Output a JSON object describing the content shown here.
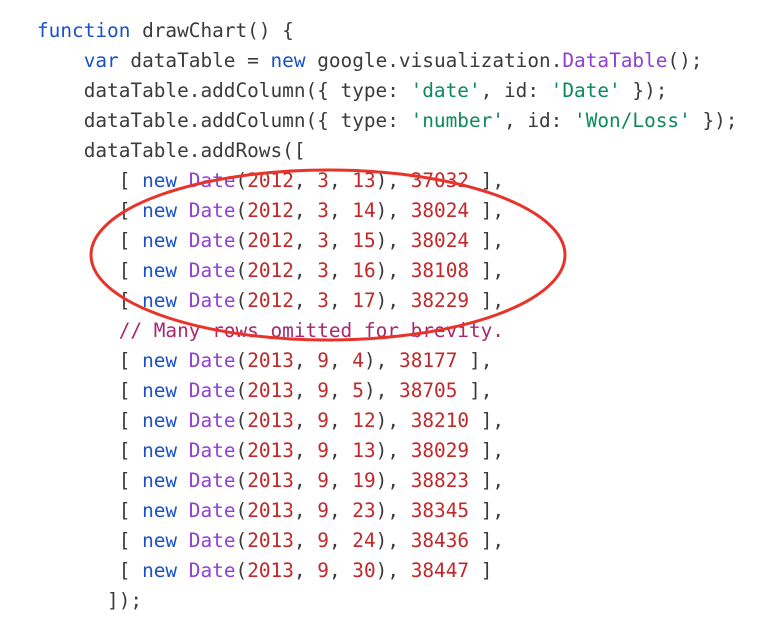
{
  "colors": {
    "keyword": "#1a52c6",
    "identifier": "#3b3b3b",
    "class_name": "#8f3fd1",
    "string": "#0b8a5a",
    "number": "#c0282a",
    "comment": "#a8276d",
    "annotation": "#e8332a",
    "background": "#ffffff"
  },
  "annotation": {
    "shape": "ellipse",
    "color": "#e8332a",
    "encloses_lines": [
      5,
      6,
      7,
      8,
      9
    ]
  },
  "code": {
    "language": "javascript",
    "lines": [
      [
        [
          "kw",
          "function"
        ],
        [
          "id",
          " drawChart() {"
        ]
      ],
      [
        [
          "id",
          "    "
        ],
        [
          "kw",
          "var"
        ],
        [
          "id",
          " dataTable = "
        ],
        [
          "kw",
          "new"
        ],
        [
          "id",
          " google.visualization."
        ],
        [
          "cls",
          "DataTable"
        ],
        [
          "id",
          "();"
        ]
      ],
      [
        [
          "id",
          "    dataTable.addColumn({ type: "
        ],
        [
          "str",
          "'date'"
        ],
        [
          "id",
          ", id: "
        ],
        [
          "str",
          "'Date'"
        ],
        [
          "id",
          " });"
        ]
      ],
      [
        [
          "id",
          "    dataTable.addColumn({ type: "
        ],
        [
          "str",
          "'number'"
        ],
        [
          "id",
          ", id: "
        ],
        [
          "str",
          "'Won/Loss'"
        ],
        [
          "id",
          " });"
        ]
      ],
      [
        [
          "id",
          "    dataTable.addRows(["
        ]
      ],
      [
        [
          "id",
          "       [ "
        ],
        [
          "kw",
          "new"
        ],
        [
          "id",
          " "
        ],
        [
          "cls",
          "Date"
        ],
        [
          "id",
          "("
        ],
        [
          "num",
          "2012"
        ],
        [
          "id",
          ", "
        ],
        [
          "num",
          "3"
        ],
        [
          "id",
          ", "
        ],
        [
          "num",
          "13"
        ],
        [
          "id",
          "), "
        ],
        [
          "num",
          "37032"
        ],
        [
          "id",
          " ],"
        ]
      ],
      [
        [
          "id",
          "       [ "
        ],
        [
          "kw",
          "new"
        ],
        [
          "id",
          " "
        ],
        [
          "cls",
          "Date"
        ],
        [
          "id",
          "("
        ],
        [
          "num",
          "2012"
        ],
        [
          "id",
          ", "
        ],
        [
          "num",
          "3"
        ],
        [
          "id",
          ", "
        ],
        [
          "num",
          "14"
        ],
        [
          "id",
          "), "
        ],
        [
          "num",
          "38024"
        ],
        [
          "id",
          " ],"
        ]
      ],
      [
        [
          "id",
          "       [ "
        ],
        [
          "kw",
          "new"
        ],
        [
          "id",
          " "
        ],
        [
          "cls",
          "Date"
        ],
        [
          "id",
          "("
        ],
        [
          "num",
          "2012"
        ],
        [
          "id",
          ", "
        ],
        [
          "num",
          "3"
        ],
        [
          "id",
          ", "
        ],
        [
          "num",
          "15"
        ],
        [
          "id",
          "), "
        ],
        [
          "num",
          "38024"
        ],
        [
          "id",
          " ],"
        ]
      ],
      [
        [
          "id",
          "       [ "
        ],
        [
          "kw",
          "new"
        ],
        [
          "id",
          " "
        ],
        [
          "cls",
          "Date"
        ],
        [
          "id",
          "("
        ],
        [
          "num",
          "2012"
        ],
        [
          "id",
          ", "
        ],
        [
          "num",
          "3"
        ],
        [
          "id",
          ", "
        ],
        [
          "num",
          "16"
        ],
        [
          "id",
          "), "
        ],
        [
          "num",
          "38108"
        ],
        [
          "id",
          " ],"
        ]
      ],
      [
        [
          "id",
          "       [ "
        ],
        [
          "kw",
          "new"
        ],
        [
          "id",
          " "
        ],
        [
          "cls",
          "Date"
        ],
        [
          "id",
          "("
        ],
        [
          "num",
          "2012"
        ],
        [
          "id",
          ", "
        ],
        [
          "num",
          "3"
        ],
        [
          "id",
          ", "
        ],
        [
          "num",
          "17"
        ],
        [
          "id",
          "), "
        ],
        [
          "num",
          "38229"
        ],
        [
          "id",
          " ],"
        ]
      ],
      [
        [
          "id",
          "       "
        ],
        [
          "com",
          "// Many rows omitted for brevity."
        ]
      ],
      [
        [
          "id",
          "       [ "
        ],
        [
          "kw",
          "new"
        ],
        [
          "id",
          " "
        ],
        [
          "cls",
          "Date"
        ],
        [
          "id",
          "("
        ],
        [
          "num",
          "2013"
        ],
        [
          "id",
          ", "
        ],
        [
          "num",
          "9"
        ],
        [
          "id",
          ", "
        ],
        [
          "num",
          "4"
        ],
        [
          "id",
          "), "
        ],
        [
          "num",
          "38177"
        ],
        [
          "id",
          " ],"
        ]
      ],
      [
        [
          "id",
          "       [ "
        ],
        [
          "kw",
          "new"
        ],
        [
          "id",
          " "
        ],
        [
          "cls",
          "Date"
        ],
        [
          "id",
          "("
        ],
        [
          "num",
          "2013"
        ],
        [
          "id",
          ", "
        ],
        [
          "num",
          "9"
        ],
        [
          "id",
          ", "
        ],
        [
          "num",
          "5"
        ],
        [
          "id",
          "), "
        ],
        [
          "num",
          "38705"
        ],
        [
          "id",
          " ],"
        ]
      ],
      [
        [
          "id",
          "       [ "
        ],
        [
          "kw",
          "new"
        ],
        [
          "id",
          " "
        ],
        [
          "cls",
          "Date"
        ],
        [
          "id",
          "("
        ],
        [
          "num",
          "2013"
        ],
        [
          "id",
          ", "
        ],
        [
          "num",
          "9"
        ],
        [
          "id",
          ", "
        ],
        [
          "num",
          "12"
        ],
        [
          "id",
          "), "
        ],
        [
          "num",
          "38210"
        ],
        [
          "id",
          " ],"
        ]
      ],
      [
        [
          "id",
          "       [ "
        ],
        [
          "kw",
          "new"
        ],
        [
          "id",
          " "
        ],
        [
          "cls",
          "Date"
        ],
        [
          "id",
          "("
        ],
        [
          "num",
          "2013"
        ],
        [
          "id",
          ", "
        ],
        [
          "num",
          "9"
        ],
        [
          "id",
          ", "
        ],
        [
          "num",
          "13"
        ],
        [
          "id",
          "), "
        ],
        [
          "num",
          "38029"
        ],
        [
          "id",
          " ],"
        ]
      ],
      [
        [
          "id",
          "       [ "
        ],
        [
          "kw",
          "new"
        ],
        [
          "id",
          " "
        ],
        [
          "cls",
          "Date"
        ],
        [
          "id",
          "("
        ],
        [
          "num",
          "2013"
        ],
        [
          "id",
          ", "
        ],
        [
          "num",
          "9"
        ],
        [
          "id",
          ", "
        ],
        [
          "num",
          "19"
        ],
        [
          "id",
          "), "
        ],
        [
          "num",
          "38823"
        ],
        [
          "id",
          " ],"
        ]
      ],
      [
        [
          "id",
          "       [ "
        ],
        [
          "kw",
          "new"
        ],
        [
          "id",
          " "
        ],
        [
          "cls",
          "Date"
        ],
        [
          "id",
          "("
        ],
        [
          "num",
          "2013"
        ],
        [
          "id",
          ", "
        ],
        [
          "num",
          "9"
        ],
        [
          "id",
          ", "
        ],
        [
          "num",
          "23"
        ],
        [
          "id",
          "), "
        ],
        [
          "num",
          "38345"
        ],
        [
          "id",
          " ],"
        ]
      ],
      [
        [
          "id",
          "       [ "
        ],
        [
          "kw",
          "new"
        ],
        [
          "id",
          " "
        ],
        [
          "cls",
          "Date"
        ],
        [
          "id",
          "("
        ],
        [
          "num",
          "2013"
        ],
        [
          "id",
          ", "
        ],
        [
          "num",
          "9"
        ],
        [
          "id",
          ", "
        ],
        [
          "num",
          "24"
        ],
        [
          "id",
          "), "
        ],
        [
          "num",
          "38436"
        ],
        [
          "id",
          " ],"
        ]
      ],
      [
        [
          "id",
          "       [ "
        ],
        [
          "kw",
          "new"
        ],
        [
          "id",
          " "
        ],
        [
          "cls",
          "Date"
        ],
        [
          "id",
          "("
        ],
        [
          "num",
          "2013"
        ],
        [
          "id",
          ", "
        ],
        [
          "num",
          "9"
        ],
        [
          "id",
          ", "
        ],
        [
          "num",
          "30"
        ],
        [
          "id",
          "), "
        ],
        [
          "num",
          "38447"
        ],
        [
          "id",
          " ]"
        ]
      ],
      [
        [
          "id",
          "      ]);"
        ]
      ]
    ]
  }
}
